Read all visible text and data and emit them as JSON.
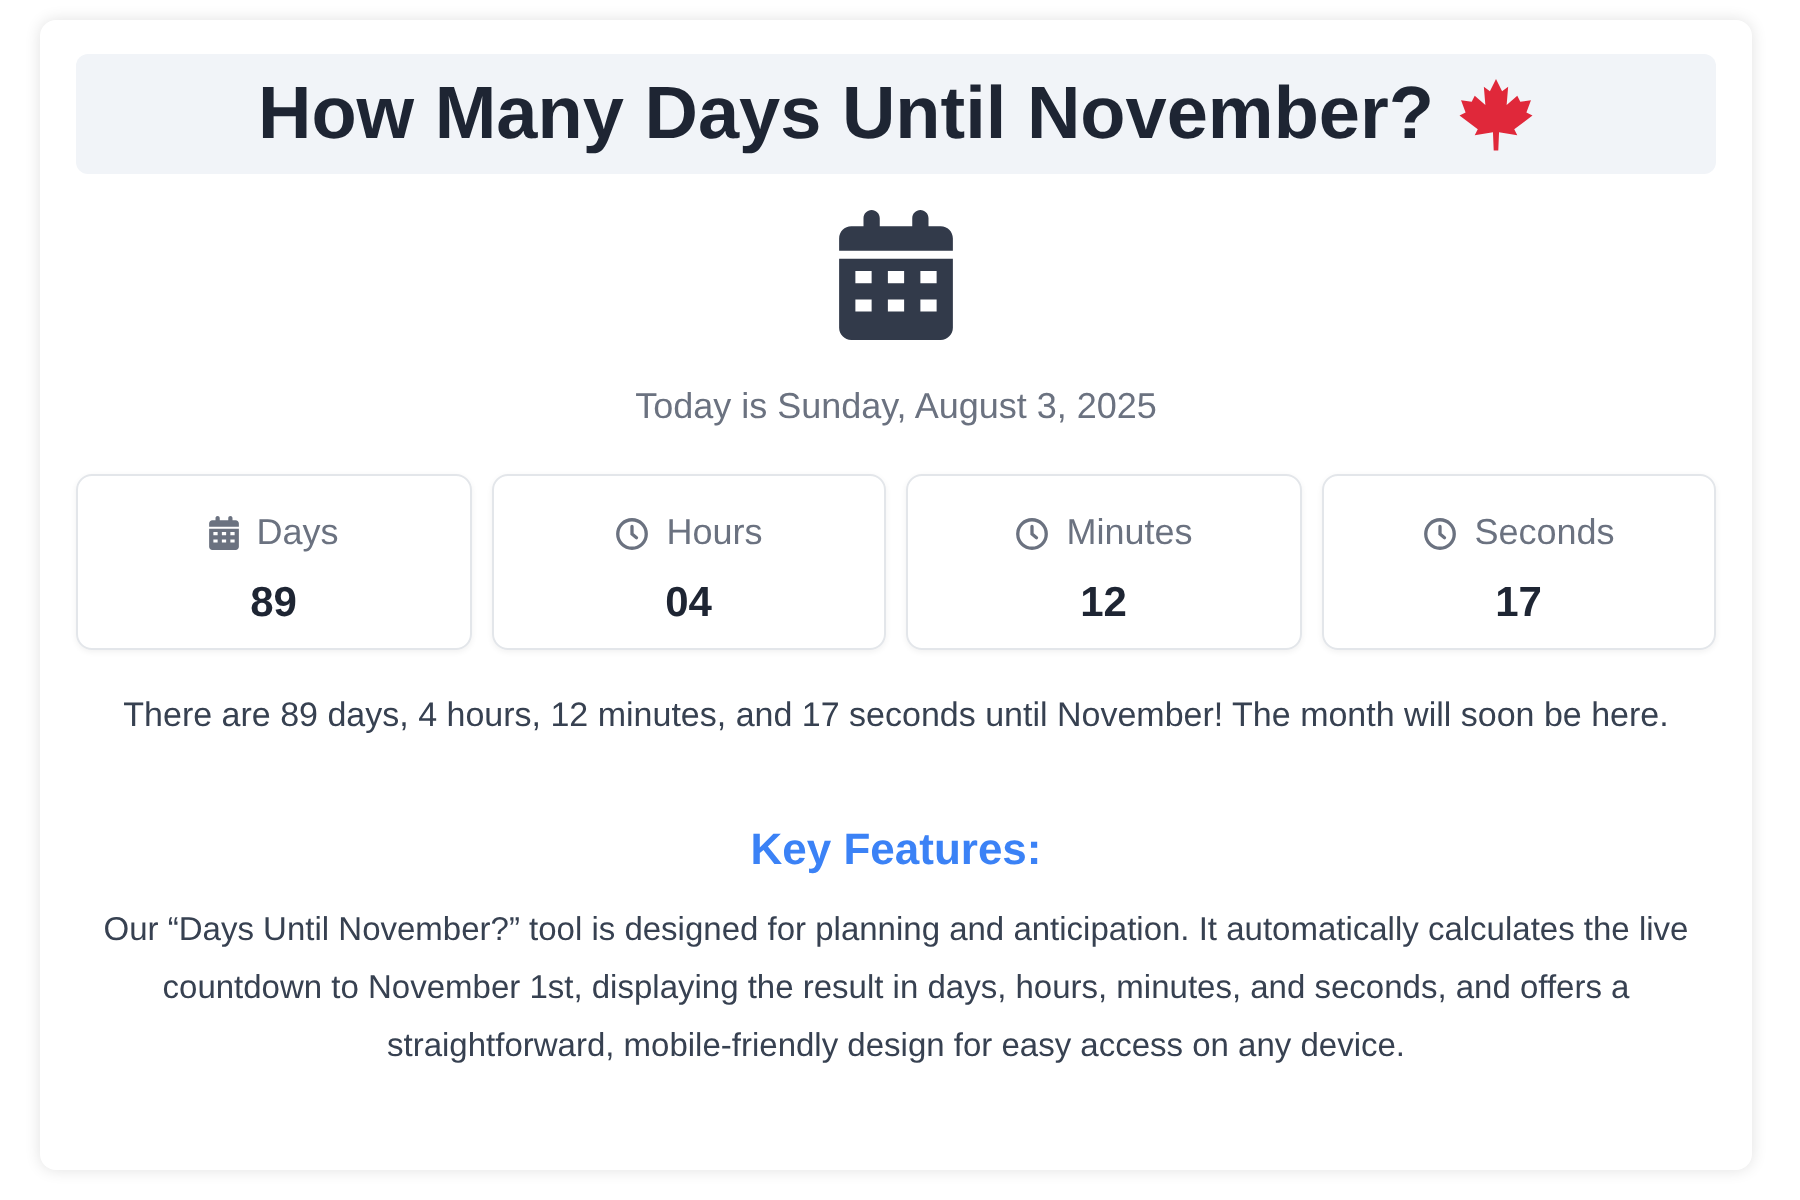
{
  "title": "How Many Days Until November?",
  "today": "Today is Sunday, August 3, 2025",
  "units": [
    {
      "kind": "calendar",
      "label": "Days",
      "value": "89"
    },
    {
      "kind": "clock",
      "label": "Hours",
      "value": "04"
    },
    {
      "kind": "clock",
      "label": "Minutes",
      "value": "12"
    },
    {
      "kind": "clock",
      "label": "Seconds",
      "value": "17"
    }
  ],
  "summary": "There are 89 days, 4 hours, 12 minutes, and 17 seconds until November! The month will soon be here.",
  "features": {
    "heading": "Key Features:",
    "text": "Our “Days Until November?” tool is designed for planning and anticipation. It automatically calculates the live countdown to November 1st, displaying the result in days, hours, minutes, and seconds, and offers a straightforward, mobile-friendly design for easy access on any device."
  }
}
